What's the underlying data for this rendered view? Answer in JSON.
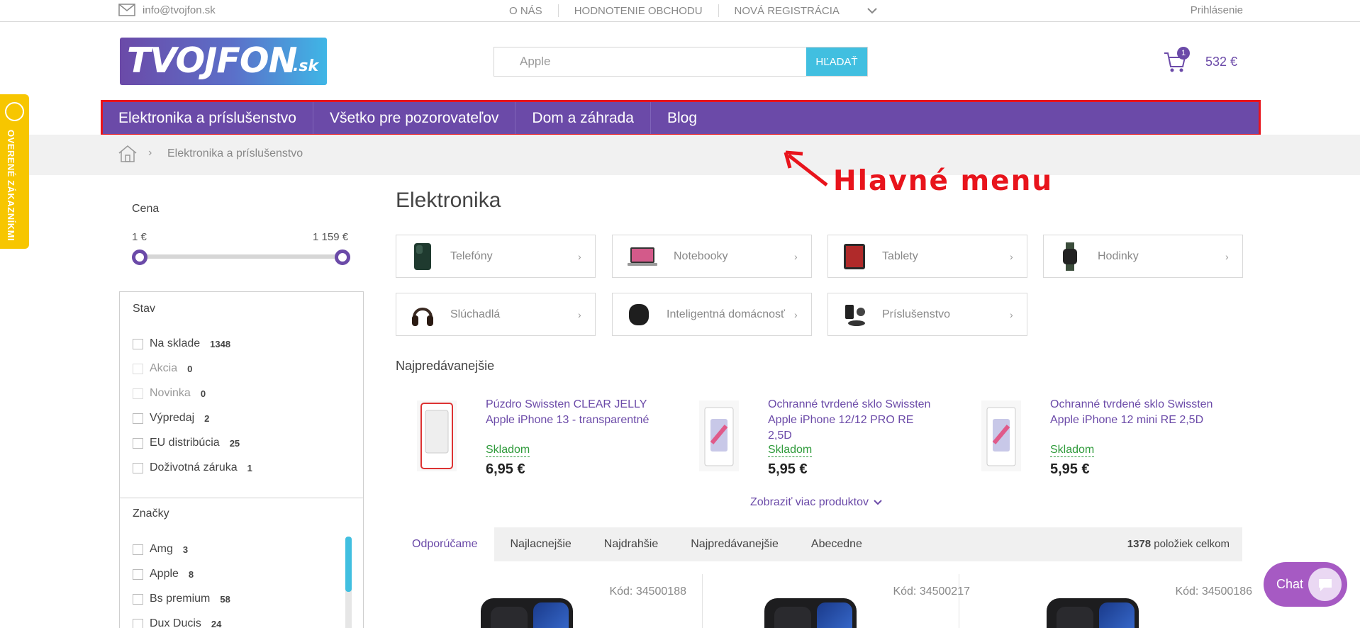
{
  "topbar": {
    "email": "info@tvojfon.sk",
    "nav": [
      "O NÁS",
      "HODNOTENIE OBCHODU",
      "NOVÁ REGISTRÁCIA"
    ],
    "login": "Prihlásenie"
  },
  "header": {
    "logo_text": "TVOJFON",
    "logo_tld": ".sk",
    "search_value": "Apple",
    "search_button": "HĽADAŤ",
    "cart_count": "1",
    "cart_total": "532 €"
  },
  "main_menu": [
    "Elektronika a príslušenstvo",
    "Všetko pre pozorovateľov",
    "Dom a záhrada",
    "Blog"
  ],
  "breadcrumb": {
    "current": "Elektronika a príslušenstvo"
  },
  "annotation": {
    "label": "Hlavné menu"
  },
  "side_badge": {
    "label": "OVERENÉ ZÁKAZNÍKMI"
  },
  "filters": {
    "price": {
      "title": "Cena",
      "min": "1 €",
      "max": "1 159 €",
      "low_fraction": 0,
      "high_fraction": 1
    },
    "stav": {
      "title": "Stav",
      "items": [
        {
          "label": "Na sklade",
          "count": "1348"
        },
        {
          "label": "Akcia",
          "count": "0"
        },
        {
          "label": "Novinka",
          "count": "0"
        },
        {
          "label": "Výpredaj",
          "count": "2"
        },
        {
          "label": "EU distribúcia",
          "count": "25"
        },
        {
          "label": "Doživotná záruka",
          "count": "1"
        }
      ]
    },
    "znacky": {
      "title": "Značky",
      "items": [
        {
          "label": "Amg",
          "count": "3"
        },
        {
          "label": "Apple",
          "count": "8"
        },
        {
          "label": "Bs premium",
          "count": "58"
        },
        {
          "label": "Dux Ducis",
          "count": "24"
        }
      ]
    }
  },
  "content": {
    "heading": "Elektronika",
    "categories": [
      {
        "name": "Telefóny",
        "icon": "phone-icon"
      },
      {
        "name": "Notebooky",
        "icon": "laptop-icon"
      },
      {
        "name": "Tablety",
        "icon": "tablet-icon"
      },
      {
        "name": "Hodinky",
        "icon": "watch-icon"
      },
      {
        "name": "Slúchadlá",
        "icon": "headphones-icon"
      },
      {
        "name": "Inteligentná domácnosť",
        "icon": "smart-speaker-icon"
      },
      {
        "name": "Príslušenstvo",
        "icon": "charger-icon"
      }
    ],
    "bestsellers_title": "Najpredávanejšie",
    "bestsellers": [
      {
        "name": "Púzdro Swissten CLEAR JELLY Apple iPhone 13 - transparentné",
        "stock": "Skladom",
        "price": "6,95 €"
      },
      {
        "name": "Ochranné tvrdené sklo Swissten Apple iPhone 12/12 PRO RE 2,5D",
        "stock": "Skladom",
        "price": "5,95 €"
      },
      {
        "name": "Ochranné tvrdené sklo Swissten Apple iPhone 12 mini RE 2,5D",
        "stock": "Skladom",
        "price": "5,95 €"
      }
    ],
    "show_more": "Zobraziť viac produktov",
    "sort_tabs": [
      "Odporúčame",
      "Najlacnejšie",
      "Najdrahšie",
      "Najpredávanejšie",
      "Abecedne"
    ],
    "total_count": "1378",
    "total_label": " položiek celkom",
    "product_codes": [
      "Kód: 34500188",
      "Kód: 34500217",
      "Kód: 34500186"
    ]
  },
  "chat": {
    "label": "Chat"
  },
  "colors": {
    "brand_purple": "#6b4aa8",
    "accent_blue": "#41bfe0",
    "annotation_red": "#e8141c",
    "stock_green": "#2e9a3a"
  }
}
